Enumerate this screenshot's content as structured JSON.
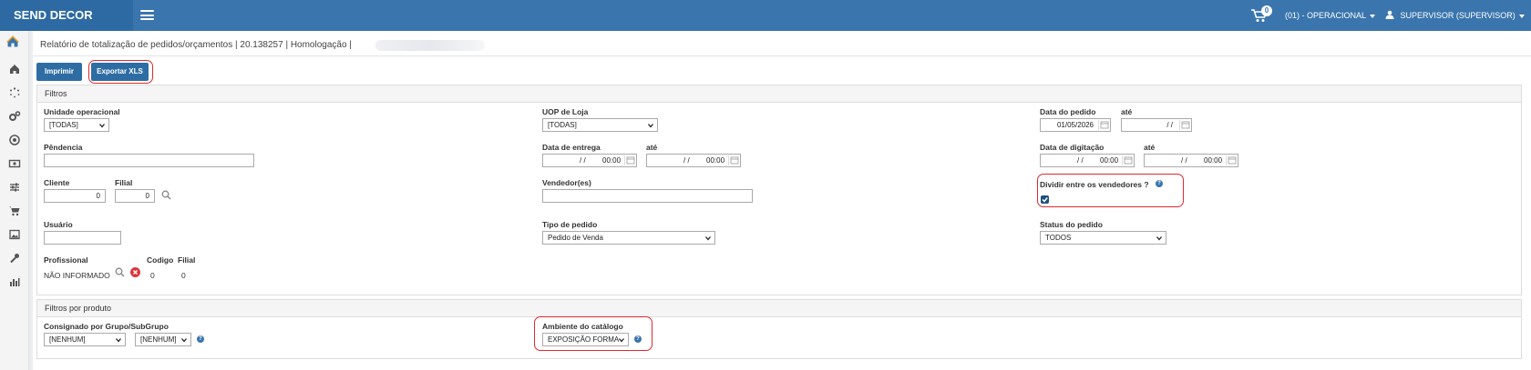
{
  "header": {
    "brand": "SEND DECOR",
    "cart_count": "0",
    "unit_menu": "(01) - OPERACIONAL",
    "user_menu": "SUPERVISOR (SUPERVISOR)"
  },
  "sidebar": {
    "icons": [
      "logo-house-icon",
      "home-icon",
      "spinner-icon",
      "cogs-icon",
      "target-icon",
      "money-icon",
      "sliders-icon",
      "cart-icon",
      "image-icon",
      "wrench-icon",
      "bar-chart-icon"
    ]
  },
  "page": {
    "title": "Relatório de totalização de pedidos/orçamentos | 20.138257 | Homologação |"
  },
  "toolbar": {
    "print_label": "Imprimir",
    "export_label": "Exportar XLS"
  },
  "filters": {
    "title": "Filtros",
    "unidade_label": "Unidade operacional",
    "unidade_value": "[TODAS]",
    "uop_label": "UOP de Loja",
    "uop_value": "[TODAS]",
    "data_pedido_label": "Data do pedido",
    "data_pedido_value": "01/05/2026",
    "ate_label": "até",
    "data_ate_value": "/ /",
    "pendencia_label": "Pêndencia",
    "pendencia_value": "",
    "data_entrega_label": "Data de entrega",
    "data_entrega_value": "/ /",
    "data_entrega_time": "00:00",
    "data_entrega_ate_value": "/ /",
    "data_entrega_ate_time": "00:00",
    "data_digitacao_label": "Data de digitação",
    "data_digitacao_value": "/ /",
    "data_digitacao_time": "00:00",
    "data_digitacao_ate_value": "/ /",
    "data_digitacao_ate_time": "00:00",
    "cliente_label": "Cliente",
    "cliente_value": "0",
    "filial_label": "Filial",
    "filial_value": "0",
    "vendedor_label": "Vendedor(es)",
    "vendedor_value": "",
    "dividir_label": "Dividir entre os vendedores ?",
    "dividir_checked": "true",
    "usuario_label": "Usuário",
    "usuario_value": "",
    "tipo_label": "Tipo de pedido",
    "tipo_value": "Pedido de Venda",
    "status_label": "Status do pedido",
    "status_value": "TODOS",
    "profissional_label": "Profissional",
    "profissional_value": "NÃO INFORMADO",
    "codigo_label": "Codigo",
    "codigo_value": "0",
    "prof_filial_label": "Filial",
    "prof_filial_value": "0"
  },
  "product_filters": {
    "title": "Filtros por produto",
    "consignado_label": "Consignado por Grupo/SubGrupo",
    "grupo_value": "[NENHUM]",
    "subgrupo_value": "[NENHUM]",
    "ambiente_label": "Ambiente do catálogo",
    "ambiente_value": "EXPOSIÇÃO FORMA"
  },
  "colors": {
    "topbar": "#3a75ad",
    "brand_bg": "#2d6aa3",
    "button": "#2e6da4",
    "highlight": "#e0282e"
  }
}
